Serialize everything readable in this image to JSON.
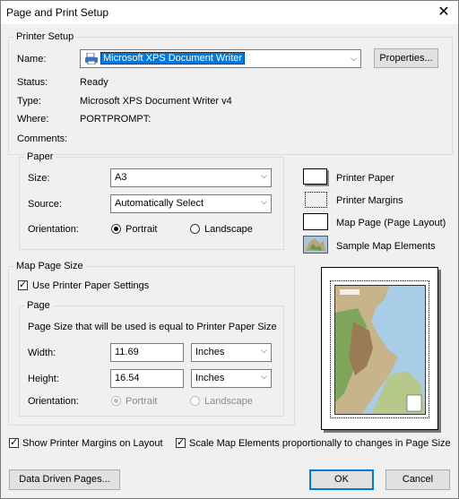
{
  "window": {
    "title": "Page and Print Setup"
  },
  "printer_setup": {
    "group_label": "Printer Setup",
    "name_label": "Name:",
    "name_value": "Microsoft XPS Document Writer",
    "properties_button": "Properties...",
    "status_label": "Status:",
    "status_value": "Ready",
    "type_label": "Type:",
    "type_value": "Microsoft XPS Document Writer v4",
    "where_label": "Where:",
    "where_value": "PORTPROMPT:",
    "comments_label": "Comments:"
  },
  "paper": {
    "group_label": "Paper",
    "size_label": "Size:",
    "size_value": "A3",
    "source_label": "Source:",
    "source_value": "Automatically Select",
    "orientation_label": "Orientation:",
    "portrait_label": "Portrait",
    "landscape_label": "Landscape",
    "orientation_selected": "Portrait"
  },
  "legend": {
    "printer_paper": "Printer Paper",
    "printer_margins": "Printer Margins",
    "map_page": "Map Page (Page Layout)",
    "sample_map_elements": "Sample Map Elements"
  },
  "map_page_size": {
    "group_label": "Map Page Size",
    "use_printer_paper_label": "Use Printer Paper Settings",
    "use_printer_paper_checked": true,
    "page_group_label": "Page",
    "info_text": "Page Size that will be used is equal to Printer Paper Size",
    "width_label": "Width:",
    "width_value": "11.69",
    "width_unit": "Inches",
    "height_label": "Height:",
    "height_value": "16.54",
    "height_unit": "Inches",
    "orientation_label": "Orientation:",
    "portrait_label": "Portrait",
    "landscape_label": "Landscape"
  },
  "options": {
    "show_margins_label": "Show Printer Margins on Layout",
    "show_margins_checked": true,
    "scale_elements_label": "Scale Map Elements proportionally to changes in Page Size",
    "scale_elements_checked": true
  },
  "buttons": {
    "data_driven_pages": "Data Driven Pages...",
    "ok": "OK",
    "cancel": "Cancel"
  },
  "colors": {
    "accent": "#0078d7",
    "background": "#f0f0f0"
  }
}
